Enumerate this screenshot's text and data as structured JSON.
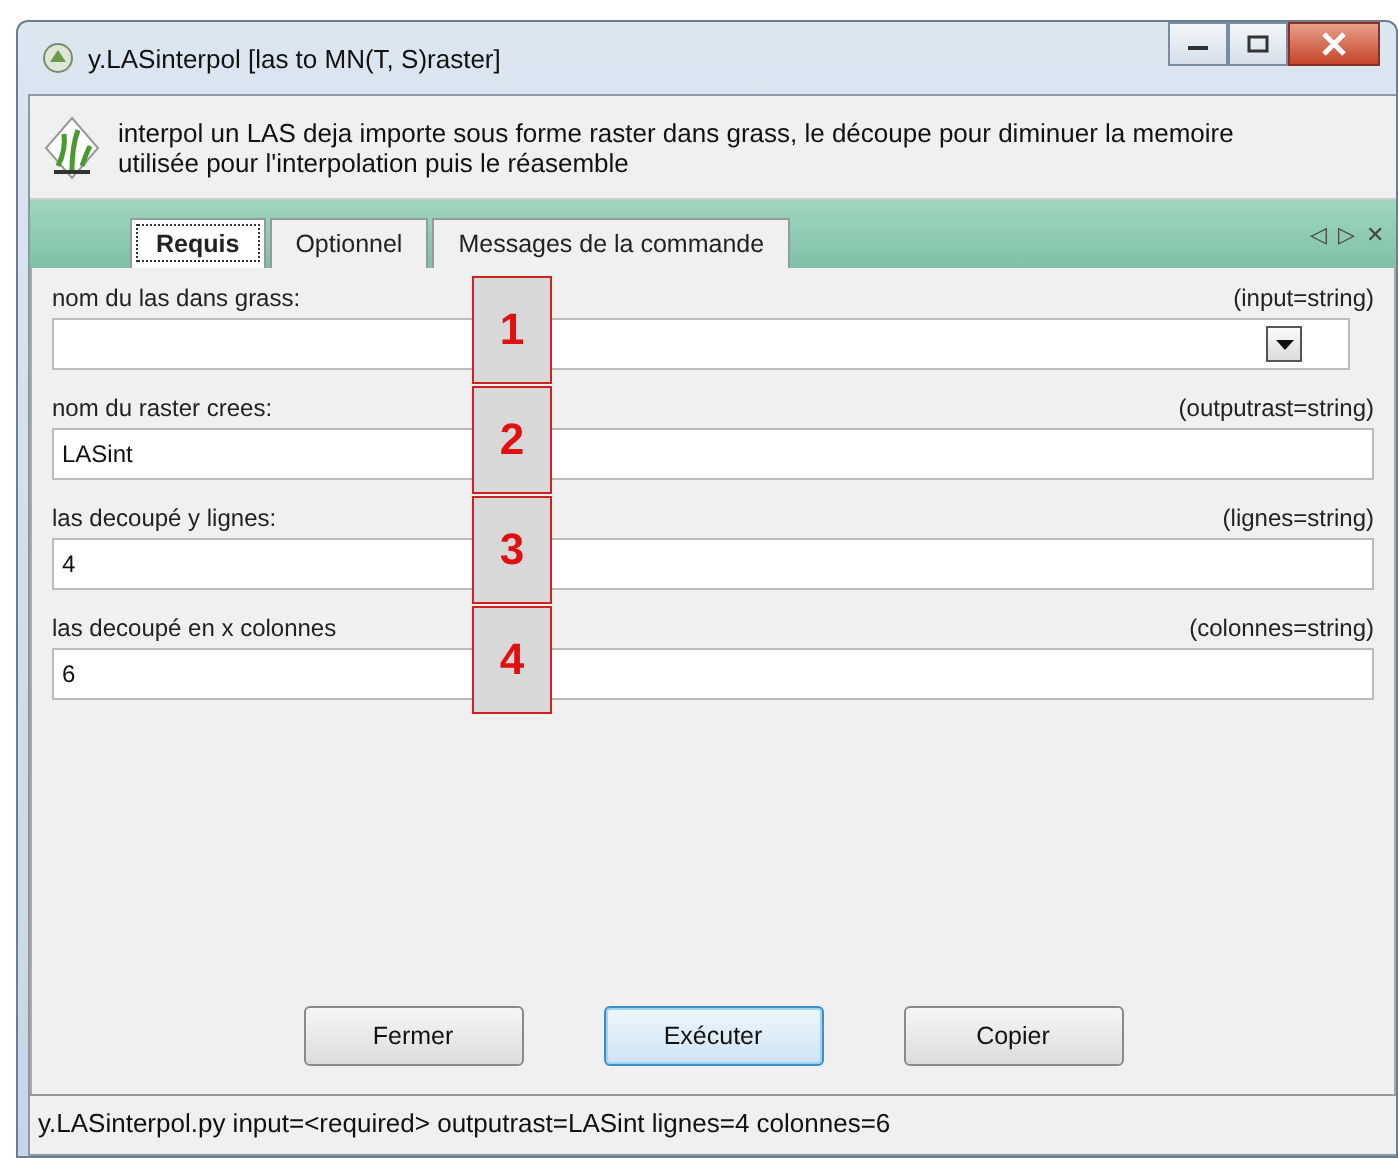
{
  "window": {
    "title": "y.LASinterpol [las to MN(T, S)raster]"
  },
  "description": "interpol un LAS deja importe sous forme raster dans grass, le découpe pour diminuer la memoire utilisée pour l'interpolation puis le réasemble",
  "tabs": [
    {
      "label": "Requis",
      "selected": true
    },
    {
      "label": "Optionnel",
      "selected": false
    },
    {
      "label": "Messages de la commande",
      "selected": false
    }
  ],
  "tab_nav": [
    "◁",
    "▷",
    "✕"
  ],
  "fields": [
    {
      "kind": "combo",
      "label": "nom du las dans grass:",
      "param": "(input=string)",
      "callout": "1"
    },
    {
      "kind": "text",
      "label": "nom du raster crees:",
      "param": "(outputrast=string)",
      "value": "LASint",
      "callout": "2"
    },
    {
      "kind": "text",
      "label": "las decoupé y lignes:",
      "param": "(lignes=string)",
      "value": "4",
      "callout": "3"
    },
    {
      "kind": "text",
      "label": "las decoupé en x colonnes",
      "param": "(colonnes=string)",
      "value": "6",
      "callout": "4"
    }
  ],
  "buttons": [
    {
      "label": "Fermer",
      "selected": false
    },
    {
      "label": "Exécuter",
      "selected": true
    },
    {
      "label": "Copier",
      "selected": false
    }
  ],
  "status_bar": "y.LASinterpol.py input=<required> outputrast=LASint lignes=4 colonnes=6"
}
